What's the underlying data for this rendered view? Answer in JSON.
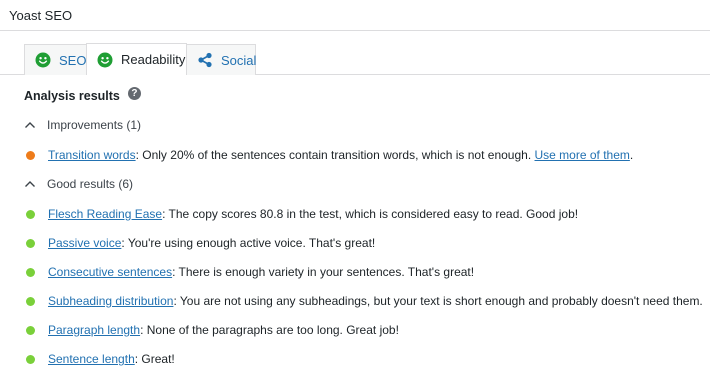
{
  "header": {
    "title": "Yoast SEO"
  },
  "tabs": [
    {
      "label": "SEO",
      "icon": "smiley-icon",
      "active": false
    },
    {
      "label": "Readability",
      "icon": "smiley-icon",
      "active": true
    },
    {
      "label": "Social",
      "icon": "share-icon",
      "active": false
    }
  ],
  "analysis": {
    "title": "Analysis results",
    "help_icon": "?"
  },
  "improvements": {
    "heading": "Improvements (1)",
    "items": [
      {
        "link": "Transition words",
        "text": ": Only 20% of the sentences contain transition words, which is not enough. ",
        "link2": "Use more of them",
        "tail": ".",
        "status_color": "#ee7c1b"
      }
    ]
  },
  "good": {
    "heading": "Good results (6)",
    "items": [
      {
        "link": "Flesch Reading Ease",
        "text": ": The copy scores 80.8 in the test, which is considered easy to read. Good job!"
      },
      {
        "link": "Passive voice",
        "text": ": You're using enough active voice. That's great!"
      },
      {
        "link": "Consecutive sentences",
        "text": ": There is enough variety in your sentences. That's great!"
      },
      {
        "link": "Subheading distribution",
        "text": ": You are not using any subheadings, but your text is short enough and probably doesn't need them."
      },
      {
        "link": "Paragraph length",
        "text": ": None of the paragraphs are too long. Great job!"
      },
      {
        "link": "Sentence length",
        "text": ": Great!"
      }
    ],
    "status_color": "#7ad03a"
  },
  "colors": {
    "smiley": "#1f9e34",
    "link": "#2271b1"
  }
}
